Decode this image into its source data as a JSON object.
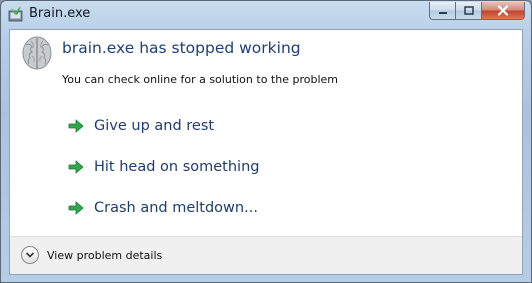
{
  "window": {
    "title": "Brain.exe"
  },
  "dialog": {
    "headline": "brain.exe has stopped working",
    "subtext": "You can check online for a solution to the problem",
    "options": [
      {
        "label": "Give up and rest",
        "icon": "green-arrow-icon"
      },
      {
        "label": "Hit head on something",
        "icon": "green-arrow-icon"
      },
      {
        "label": "Crash and meltdown...",
        "icon": "green-arrow-icon"
      }
    ]
  },
  "footer": {
    "details_label": "View problem details"
  },
  "colors": {
    "headline": "#1d3f78",
    "option_text": "#1e3d6e",
    "arrow": "#2ea84a",
    "close_button": "#c4432a"
  }
}
